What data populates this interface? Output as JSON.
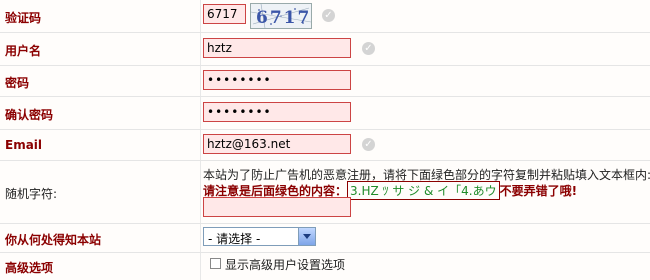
{
  "fields": {
    "captcha": {
      "label": "验证码",
      "value": "6717",
      "image_text": "6717"
    },
    "username": {
      "label": "用户名",
      "value": "hztz"
    },
    "password": {
      "label": "密码",
      "value": "••••••••"
    },
    "confirm_password": {
      "label": "确认密码",
      "value": "••••••••"
    },
    "email": {
      "label": "Email",
      "value": "hztz@163.net"
    },
    "random_chars": {
      "label": "随机字符:",
      "hint_line1": "本站为了防止广告机的恶意注册，请将下面绿色部分的字符复制并粘贴填入文本框内:",
      "hint_prefix": "请注意是后面绿色的内容：",
      "green_text": "3.HZ ﾂ サ ジ & イ「4.あウ",
      "hint_suffix": "不要弄错了哦!",
      "value": ""
    },
    "referral_source": {
      "label": "你从何处得知本站",
      "selected": "- 请选择 -"
    },
    "advanced": {
      "label": "高级选项",
      "checkbox_label": "显示高级用户设置选项",
      "checked": false
    }
  },
  "colors": {
    "label_red": "#8b0000",
    "input_bg": "#ffe8e8",
    "input_border": "#cc4444",
    "green": "#1f8b2a"
  },
  "icons": {
    "valid": "check-circle-icon",
    "dropdown": "chevron-down-icon"
  }
}
